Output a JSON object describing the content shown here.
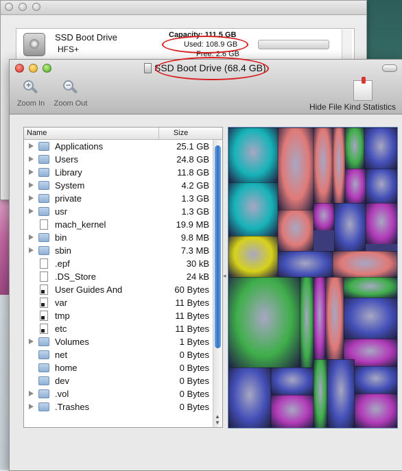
{
  "back_window": {
    "disk_name": "SSD Boot Drive",
    "format": "HFS+",
    "capacity": "Capacity: 111.5 GB",
    "used": "Used: 108.9 GB",
    "free": "Free: 2.6 GB"
  },
  "window": {
    "title": "SSD Boot Drive (68.4 GB)"
  },
  "toolbar": {
    "zoom_in": "Zoom In",
    "zoom_out": "Zoom Out",
    "hide_stats": "Hide File Kind Statistics"
  },
  "outline": {
    "col_name": "Name",
    "col_size": "Size",
    "rows": [
      {
        "name": "Applications",
        "size": "25.1 GB",
        "kind": "folder",
        "expandable": true
      },
      {
        "name": "Users",
        "size": "24.8 GB",
        "kind": "folder",
        "expandable": true
      },
      {
        "name": "Library",
        "size": "11.8 GB",
        "kind": "folder",
        "expandable": true
      },
      {
        "name": "System",
        "size": "4.2 GB",
        "kind": "folder",
        "expandable": true
      },
      {
        "name": "private",
        "size": "1.3 GB",
        "kind": "folder",
        "expandable": true
      },
      {
        "name": "usr",
        "size": "1.3 GB",
        "kind": "folder",
        "expandable": true
      },
      {
        "name": "mach_kernel",
        "size": "19.9 MB",
        "kind": "file",
        "expandable": false
      },
      {
        "name": "bin",
        "size": "9.8 MB",
        "kind": "folder",
        "expandable": true
      },
      {
        "name": "sbin",
        "size": "7.3 MB",
        "kind": "folder",
        "expandable": true
      },
      {
        "name": ".epf",
        "size": "30 kB",
        "kind": "file",
        "expandable": false
      },
      {
        "name": ".DS_Store",
        "size": "24 kB",
        "kind": "file",
        "expandable": false
      },
      {
        "name": "User Guides And",
        "size": "60 Bytes",
        "kind": "alias",
        "expandable": false
      },
      {
        "name": "var",
        "size": "11 Bytes",
        "kind": "alias",
        "expandable": false
      },
      {
        "name": "tmp",
        "size": "11 Bytes",
        "kind": "alias",
        "expandable": false
      },
      {
        "name": "etc",
        "size": "11 Bytes",
        "kind": "alias",
        "expandable": false
      },
      {
        "name": "Volumes",
        "size": "1 Bytes",
        "kind": "folder",
        "expandable": true
      },
      {
        "name": "net",
        "size": "0 Bytes",
        "kind": "folder",
        "expandable": false
      },
      {
        "name": "home",
        "size": "0 Bytes",
        "kind": "folder",
        "expandable": false
      },
      {
        "name": "dev",
        "size": "0 Bytes",
        "kind": "folder",
        "expandable": false
      },
      {
        "name": ".vol",
        "size": "0 Bytes",
        "kind": "folder",
        "expandable": true
      },
      {
        "name": ".Trashes",
        "size": "0 Bytes",
        "kind": "folder",
        "expandable": true
      }
    ]
  },
  "colors": {
    "annotation_red": "#d81e1e",
    "scroll_blue": "#2f73c9",
    "treemap_cyan": "#16b3b8",
    "treemap_salmon": "#e07a78",
    "treemap_green": "#3fae4a",
    "treemap_yellow": "#d7d21a",
    "treemap_purple": "#b23ab8",
    "treemap_blue": "#4450b8"
  }
}
